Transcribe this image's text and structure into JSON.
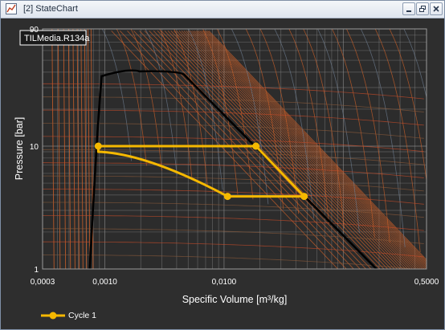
{
  "window": {
    "title": "[2] StateChart"
  },
  "icons": {
    "app": "statechart-window-icon",
    "minimize": "minimize-icon",
    "restore": "restore-icon",
    "close": "close-icon"
  },
  "colors": {
    "plot_background": "#2e2e2e",
    "grid": "#8a8a8a",
    "saturation_dome": "#000000",
    "isolines": "#d0622a",
    "cycle": "#f5b800"
  },
  "chart_data": {
    "type": "line",
    "medium_label": "TILMedia.R134a",
    "xlabel": "Specific Volume [m³/kg]",
    "ylabel": "Pressure [bar]",
    "x_scale": "log",
    "y_scale": "log",
    "xlim": [
      0.0003,
      0.5
    ],
    "ylim": [
      1,
      90
    ],
    "x_ticks": [
      "0,0003",
      "0,0010",
      "0,0100",
      "0,5000"
    ],
    "y_ticks": [
      "1",
      "10",
      "90"
    ],
    "grid": true,
    "legend_position": "bottom-left",
    "series": [
      {
        "name": "Cycle 1",
        "points": [
          {
            "v": 0.00088,
            "p": 10.0
          },
          {
            "v": 0.0185,
            "p": 10.0
          },
          {
            "v": 0.047,
            "p": 3.9
          },
          {
            "v": 0.0107,
            "p": 3.9
          },
          {
            "v": 0.00088,
            "p": 9.0
          },
          {
            "v": 0.00088,
            "p": 10.0
          }
        ],
        "markers": [
          {
            "v": 0.00088,
            "p": 10.0
          },
          {
            "v": 0.0185,
            "p": 10.0
          },
          {
            "v": 0.047,
            "p": 3.9
          },
          {
            "v": 0.0107,
            "p": 3.9
          }
        ]
      }
    ]
  }
}
